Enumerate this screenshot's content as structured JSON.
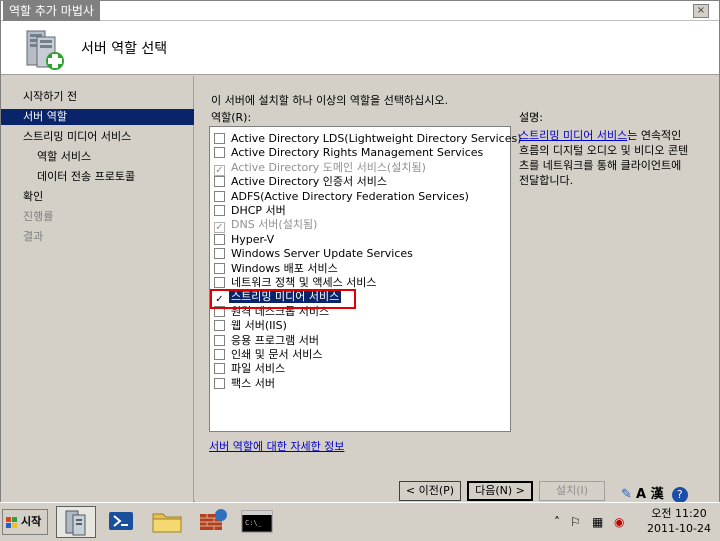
{
  "window": {
    "title": "역할 추가 마법사",
    "close_label": "×"
  },
  "banner": {
    "heading": "서버 역할 선택"
  },
  "sidebar": {
    "items": [
      {
        "label": "시작하기 전",
        "level": 0,
        "state": "normal"
      },
      {
        "label": "서버 역할",
        "level": 0,
        "state": "selected"
      },
      {
        "label": "스트리밍 미디어 서비스",
        "level": 0,
        "state": "normal"
      },
      {
        "label": "역할 서비스",
        "level": 1,
        "state": "normal"
      },
      {
        "label": "데이터 전송 프로토콜",
        "level": 1,
        "state": "normal"
      },
      {
        "label": "확인",
        "level": 0,
        "state": "normal"
      },
      {
        "label": "진행률",
        "level": 0,
        "state": "dim"
      },
      {
        "label": "결과",
        "level": 0,
        "state": "dim"
      }
    ]
  },
  "main": {
    "instruction": "이 서버에 설치할 하나 이상의 역할을 선택하십시오.",
    "roles_label": "역할(R):",
    "description_label": "설명:",
    "description_link": "스트리밍 미디어 서비스",
    "description_text": "는 연속적인 흐름의 디지털 오디오 및 비디오 콘텐츠를 네트워크를 통해 클라이언트에 전달합니다.",
    "more_info_link": "서버 역할에 대한 자세한 정보",
    "roles": [
      {
        "label": "Active Directory LDS(Lightweight Directory Services)",
        "checked": false,
        "disabled": false,
        "selected": false
      },
      {
        "label": "Active Directory Rights Management Services",
        "checked": false,
        "disabled": false,
        "selected": false
      },
      {
        "label": "Active Directory 도메인 서비스(설치됨)",
        "checked": true,
        "disabled": true,
        "selected": false
      },
      {
        "label": "Active Directory 인증서 서비스",
        "checked": false,
        "disabled": false,
        "selected": false
      },
      {
        "label": "ADFS(Active Directory Federation Services)",
        "checked": false,
        "disabled": false,
        "selected": false
      },
      {
        "label": "DHCP 서버",
        "checked": false,
        "disabled": false,
        "selected": false
      },
      {
        "label": "DNS 서버(설치됨)",
        "checked": true,
        "disabled": true,
        "selected": false
      },
      {
        "label": "Hyper-V",
        "checked": false,
        "disabled": false,
        "selected": false
      },
      {
        "label": "Windows Server Update Services",
        "checked": false,
        "disabled": false,
        "selected": false
      },
      {
        "label": "Windows 배포 서비스",
        "checked": false,
        "disabled": false,
        "selected": false
      },
      {
        "label": "네트워크 정책 및 액세스 서비스",
        "checked": false,
        "disabled": false,
        "selected": false
      },
      {
        "label": "스트리밍 미디어 서비스",
        "checked": true,
        "disabled": false,
        "selected": true
      },
      {
        "label": "원격 데스크톱 서비스",
        "checked": false,
        "disabled": false,
        "selected": false
      },
      {
        "label": "웹 서버(IIS)",
        "checked": false,
        "disabled": false,
        "selected": false
      },
      {
        "label": "응용 프로그램 서버",
        "checked": false,
        "disabled": false,
        "selected": false
      },
      {
        "label": "인쇄 및 문서 서비스",
        "checked": false,
        "disabled": false,
        "selected": false
      },
      {
        "label": "파일 서비스",
        "checked": false,
        "disabled": false,
        "selected": false
      },
      {
        "label": "팩스 서버",
        "checked": false,
        "disabled": false,
        "selected": false
      }
    ]
  },
  "buttons": {
    "prev": "< 이전(P)",
    "next": "다음(N) >",
    "install": "설치(I)"
  },
  "taskbar": {
    "start_label": "시작",
    "clock_time": "오전 11:20",
    "clock_date": "2011-10-24",
    "lang": "A 漢"
  },
  "colors": {
    "selection": "#0a246a",
    "highlight_box": "#e00000",
    "link": "#0000cc"
  }
}
